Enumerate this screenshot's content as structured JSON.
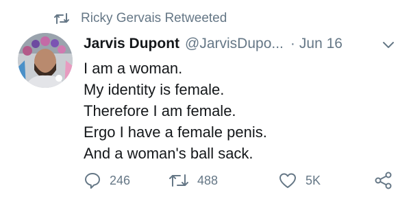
{
  "retweet_header": {
    "text": "Ricky Gervais Retweeted",
    "icon": "retweet-icon"
  },
  "author": {
    "display_name": "Jarvis Dupont",
    "handle": "@JarvisDupo...",
    "separator": "·",
    "date": "Jun 16"
  },
  "tweet": {
    "lines": [
      "I am a woman.",
      "My identity is female.",
      "Therefore I am female.",
      "Ergo I have a female penis.",
      "And a woman's ball sack."
    ]
  },
  "actions": {
    "reply_count": "246",
    "retweet_count": "488",
    "like_count": "5K"
  },
  "colors": {
    "secondary_text": "#657786",
    "primary_text": "#14171a",
    "background": "#ffffff"
  }
}
